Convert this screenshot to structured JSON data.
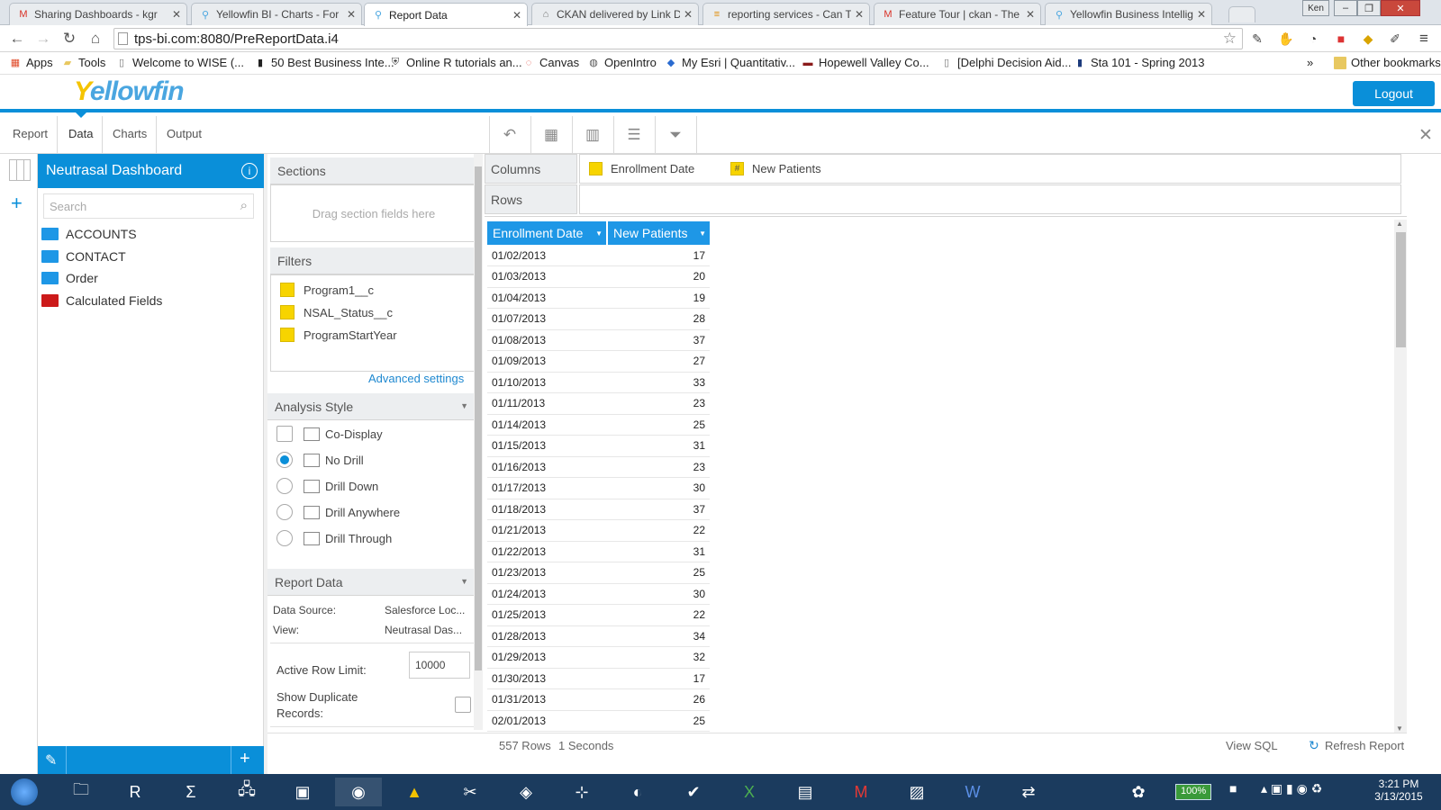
{
  "browser": {
    "tabs": [
      {
        "title": "Sharing Dashboards - kgr",
        "icon": "gmail-icon"
      },
      {
        "title": "Yellowfin BI - Charts - For",
        "icon": "yellowfin-icon"
      },
      {
        "title": "Report Data",
        "icon": "yellowfin-icon",
        "active": true
      },
      {
        "title": "CKAN delivered by Link Di",
        "icon": "ckan-icon"
      },
      {
        "title": "reporting services - Can T",
        "icon": "stack-icon"
      },
      {
        "title": "Feature Tour | ckan - The",
        "icon": "gmail-icon"
      },
      {
        "title": "Yellowfin Business Intellig",
        "icon": "yellowfin-icon"
      }
    ],
    "user_badge": "Ken",
    "url": "tps-bi.com:8080/PreReportData.i4",
    "bookmarks": [
      "Apps",
      "Tools",
      "Welcome to WISE (...",
      "50 Best Business Inte...",
      "Online R tutorials an...",
      "Canvas",
      "OpenIntro",
      "My Esri | Quantitativ...",
      "Hopewell Valley Co...",
      "[Delphi Decision Aid...",
      "Sta 101 - Spring 2013"
    ],
    "bookmarks_overflow": "»",
    "other_bookmarks": "Other bookmarks"
  },
  "app": {
    "logo_y": "Y",
    "logo_rest": "ellowfin",
    "logout_label": "Logout",
    "toolbar_tabs": [
      "Report",
      "Data",
      "Charts",
      "Output"
    ],
    "active_toolbar_tab": "Data"
  },
  "left": {
    "view_title": "Neutrasal Dashboard",
    "search_placeholder": "Search",
    "tree": [
      {
        "label": "ACCOUNTS",
        "color": "#1e97e6"
      },
      {
        "label": "CONTACT",
        "color": "#1e97e6"
      },
      {
        "label": "Order",
        "color": "#1e97e6"
      },
      {
        "label": "Calculated Fields",
        "color": "#cc1a1a"
      }
    ]
  },
  "middle": {
    "sections_title": "Sections",
    "sections_placeholder": "Drag section fields here",
    "filters_title": "Filters",
    "filters": [
      "Program1__c",
      "NSAL_Status__c",
      "ProgramStartYear"
    ],
    "advanced_settings": "Advanced settings",
    "analysis_title": "Analysis Style",
    "analysis_options": [
      "Co-Display",
      "No Drill",
      "Drill Down",
      "Drill Anywhere",
      "Drill Through"
    ],
    "analysis_selected": "No Drill",
    "report_data_title": "Report Data",
    "data_source_label": "Data Source:",
    "data_source_value": "Salesforce Loc...",
    "view_label": "View:",
    "view_value": "Neutrasal Das...",
    "row_limit_label": "Active Row Limit:",
    "row_limit_value": "10000",
    "show_dup_label_1": "Show Duplicate",
    "show_dup_label_2": "Records:"
  },
  "main": {
    "columns_label": "Columns",
    "rows_label": "Rows",
    "column_chips": [
      {
        "label": "Enrollment Date",
        "icon": ""
      },
      {
        "label": "New Patients",
        "icon": "#"
      }
    ],
    "headers": [
      "Enrollment Date",
      "New Patients"
    ],
    "rows": [
      [
        "01/02/2013",
        "17"
      ],
      [
        "01/03/2013",
        "20"
      ],
      [
        "01/04/2013",
        "19"
      ],
      [
        "01/07/2013",
        "28"
      ],
      [
        "01/08/2013",
        "37"
      ],
      [
        "01/09/2013",
        "27"
      ],
      [
        "01/10/2013",
        "33"
      ],
      [
        "01/11/2013",
        "23"
      ],
      [
        "01/14/2013",
        "25"
      ],
      [
        "01/15/2013",
        "31"
      ],
      [
        "01/16/2013",
        "23"
      ],
      [
        "01/17/2013",
        "30"
      ],
      [
        "01/18/2013",
        "37"
      ],
      [
        "01/21/2013",
        "22"
      ],
      [
        "01/22/2013",
        "31"
      ],
      [
        "01/23/2013",
        "25"
      ],
      [
        "01/24/2013",
        "30"
      ],
      [
        "01/25/2013",
        "22"
      ],
      [
        "01/28/2013",
        "34"
      ],
      [
        "01/29/2013",
        "32"
      ],
      [
        "01/30/2013",
        "17"
      ],
      [
        "01/31/2013",
        "26"
      ],
      [
        "02/01/2013",
        "25"
      ]
    ],
    "row_count": "557 Rows",
    "duration": "1 Seconds",
    "view_sql": "View SQL",
    "refresh": "Refresh Report"
  },
  "taskbar": {
    "battery": "100%",
    "time": "3:21 PM",
    "date": "3/13/2015"
  }
}
